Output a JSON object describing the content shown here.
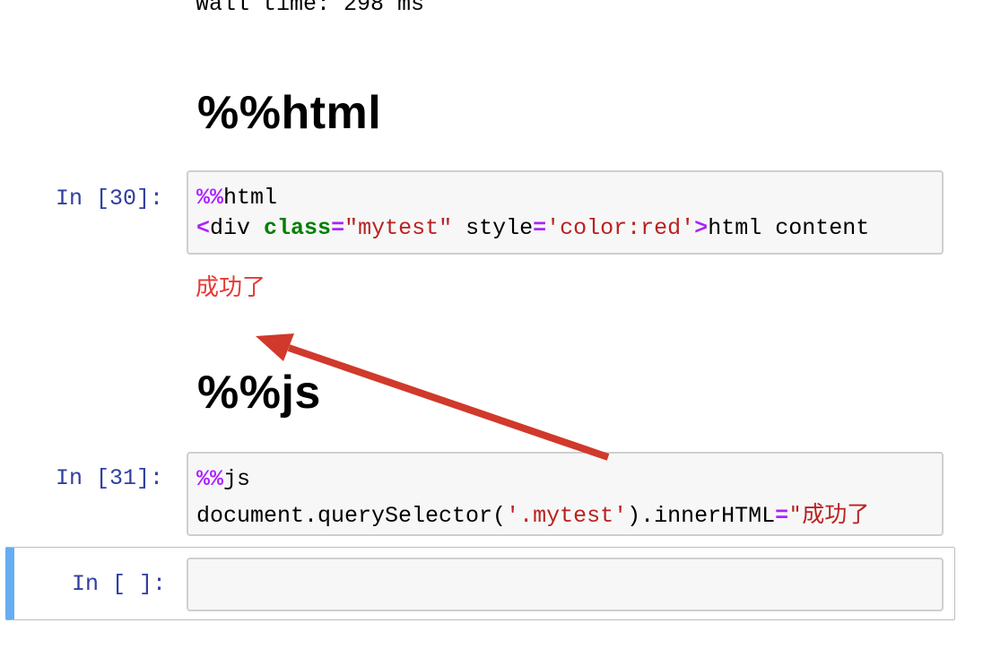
{
  "previous_output": "Wall time: 298 ms",
  "headings": {
    "html_heading": "%%html",
    "js_heading": "%%js"
  },
  "cells": [
    {
      "prompt": "In [30]:",
      "line1_magic": "%%",
      "line1_rest": "html",
      "line2": {
        "lt": "<",
        "tag": "div",
        "space1": " ",
        "attr_class": "class",
        "eq1": "=",
        "class_val": "\"mytest\"",
        "space2": " style",
        "eq2": "=",
        "style_val": "'color:red'",
        "gt": ">",
        "content": "html content"
      },
      "output": "成功了"
    },
    {
      "prompt": "In [31]:",
      "line1_magic": "%%",
      "line1_rest": "js",
      "line2": {
        "pre": "document.querySelector(",
        "arg": "'.mytest'",
        "mid": ").innerHTML",
        "eq": "=",
        "val": "\"成功了"
      }
    },
    {
      "prompt": "In [ ]:"
    }
  ],
  "colors": {
    "prompt": "#303F9F",
    "magic": "#AA22FF",
    "keyword": "#008000",
    "string": "#BA2121",
    "output_red": "#e53935",
    "selected_bar": "#66aef0",
    "arrow": "#d0392b"
  }
}
